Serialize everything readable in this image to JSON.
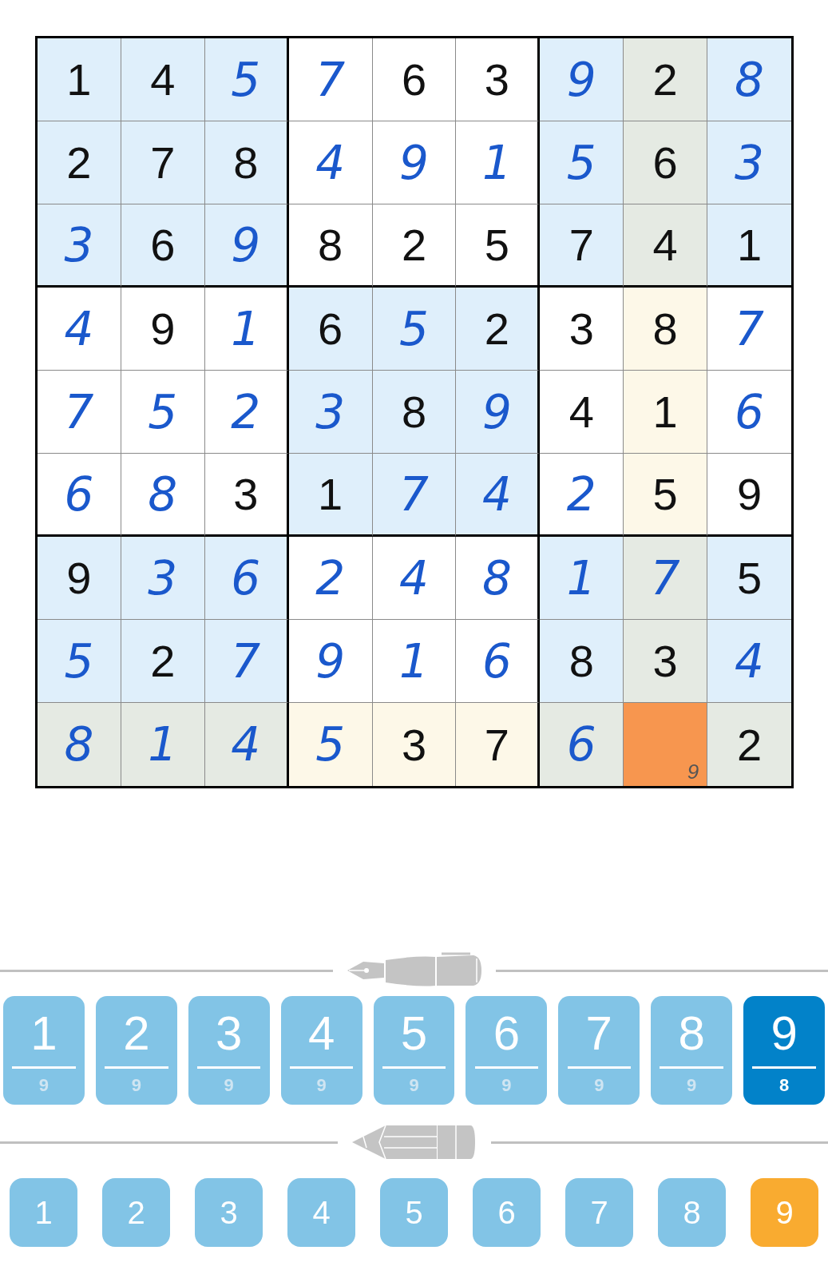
{
  "grid": {
    "rows": [
      {
        "cells": [
          {
            "value": "1",
            "kind": "given",
            "color": "#dfeffb"
          },
          {
            "value": "4",
            "kind": "given",
            "color": "#dfeffb"
          },
          {
            "value": "5",
            "kind": "entered",
            "color": "#dfeffb"
          },
          {
            "value": "7",
            "kind": "entered",
            "color": "#ffffff"
          },
          {
            "value": "6",
            "kind": "given",
            "color": "#ffffff"
          },
          {
            "value": "3",
            "kind": "given",
            "color": "#ffffff"
          },
          {
            "value": "9",
            "kind": "entered",
            "color": "#dfeffb"
          },
          {
            "value": "2",
            "kind": "given",
            "color": "#e5eae3"
          },
          {
            "value": "8",
            "kind": "entered",
            "color": "#dfeffb"
          }
        ]
      },
      {
        "cells": [
          {
            "value": "2",
            "kind": "given",
            "color": "#dfeffb"
          },
          {
            "value": "7",
            "kind": "given",
            "color": "#dfeffb"
          },
          {
            "value": "8",
            "kind": "given",
            "color": "#dfeffb"
          },
          {
            "value": "4",
            "kind": "entered",
            "color": "#ffffff"
          },
          {
            "value": "9",
            "kind": "entered",
            "color": "#ffffff"
          },
          {
            "value": "1",
            "kind": "entered",
            "color": "#ffffff"
          },
          {
            "value": "5",
            "kind": "entered",
            "color": "#dfeffb"
          },
          {
            "value": "6",
            "kind": "given",
            "color": "#e5eae3"
          },
          {
            "value": "3",
            "kind": "entered",
            "color": "#dfeffb"
          }
        ]
      },
      {
        "cells": [
          {
            "value": "3",
            "kind": "entered",
            "color": "#dfeffb"
          },
          {
            "value": "6",
            "kind": "given",
            "color": "#dfeffb"
          },
          {
            "value": "9",
            "kind": "entered",
            "color": "#dfeffb"
          },
          {
            "value": "8",
            "kind": "given",
            "color": "#ffffff"
          },
          {
            "value": "2",
            "kind": "given",
            "color": "#ffffff"
          },
          {
            "value": "5",
            "kind": "given",
            "color": "#ffffff"
          },
          {
            "value": "7",
            "kind": "given",
            "color": "#dfeffb"
          },
          {
            "value": "4",
            "kind": "given",
            "color": "#e5eae3"
          },
          {
            "value": "1",
            "kind": "given",
            "color": "#dfeffb"
          }
        ]
      },
      {
        "cells": [
          {
            "value": "4",
            "kind": "entered",
            "color": "#ffffff"
          },
          {
            "value": "9",
            "kind": "given",
            "color": "#ffffff"
          },
          {
            "value": "1",
            "kind": "entered",
            "color": "#ffffff"
          },
          {
            "value": "6",
            "kind": "given",
            "color": "#dfeffb"
          },
          {
            "value": "5",
            "kind": "entered",
            "color": "#dfeffb"
          },
          {
            "value": "2",
            "kind": "given",
            "color": "#dfeffb"
          },
          {
            "value": "3",
            "kind": "given",
            "color": "#ffffff"
          },
          {
            "value": "8",
            "kind": "given",
            "color": "#fdf8e8"
          },
          {
            "value": "7",
            "kind": "entered",
            "color": "#ffffff"
          }
        ]
      },
      {
        "cells": [
          {
            "value": "7",
            "kind": "entered",
            "color": "#ffffff"
          },
          {
            "value": "5",
            "kind": "entered",
            "color": "#ffffff"
          },
          {
            "value": "2",
            "kind": "entered",
            "color": "#ffffff"
          },
          {
            "value": "3",
            "kind": "entered",
            "color": "#dfeffb"
          },
          {
            "value": "8",
            "kind": "given",
            "color": "#dfeffb"
          },
          {
            "value": "9",
            "kind": "entered",
            "color": "#dfeffb"
          },
          {
            "value": "4",
            "kind": "given",
            "color": "#ffffff"
          },
          {
            "value": "1",
            "kind": "given",
            "color": "#fdf8e8"
          },
          {
            "value": "6",
            "kind": "entered",
            "color": "#ffffff"
          }
        ]
      },
      {
        "cells": [
          {
            "value": "6",
            "kind": "entered",
            "color": "#ffffff"
          },
          {
            "value": "8",
            "kind": "entered",
            "color": "#ffffff"
          },
          {
            "value": "3",
            "kind": "given",
            "color": "#ffffff"
          },
          {
            "value": "1",
            "kind": "given",
            "color": "#dfeffb"
          },
          {
            "value": "7",
            "kind": "entered",
            "color": "#dfeffb"
          },
          {
            "value": "4",
            "kind": "entered",
            "color": "#dfeffb"
          },
          {
            "value": "2",
            "kind": "entered",
            "color": "#ffffff"
          },
          {
            "value": "5",
            "kind": "given",
            "color": "#fdf8e8"
          },
          {
            "value": "9",
            "kind": "given",
            "color": "#ffffff"
          }
        ]
      },
      {
        "cells": [
          {
            "value": "9",
            "kind": "given",
            "color": "#dfeffb"
          },
          {
            "value": "3",
            "kind": "entered",
            "color": "#dfeffb"
          },
          {
            "value": "6",
            "kind": "entered",
            "color": "#dfeffb"
          },
          {
            "value": "2",
            "kind": "entered",
            "color": "#ffffff"
          },
          {
            "value": "4",
            "kind": "entered",
            "color": "#ffffff"
          },
          {
            "value": "8",
            "kind": "entered",
            "color": "#ffffff"
          },
          {
            "value": "1",
            "kind": "entered",
            "color": "#dfeffb"
          },
          {
            "value": "7",
            "kind": "entered",
            "color": "#e5eae3"
          },
          {
            "value": "5",
            "kind": "given",
            "color": "#dfeffb"
          }
        ]
      },
      {
        "cells": [
          {
            "value": "5",
            "kind": "entered",
            "color": "#dfeffb"
          },
          {
            "value": "2",
            "kind": "given",
            "color": "#dfeffb"
          },
          {
            "value": "7",
            "kind": "entered",
            "color": "#dfeffb"
          },
          {
            "value": "9",
            "kind": "entered",
            "color": "#ffffff"
          },
          {
            "value": "1",
            "kind": "entered",
            "color": "#ffffff"
          },
          {
            "value": "6",
            "kind": "entered",
            "color": "#ffffff"
          },
          {
            "value": "8",
            "kind": "given",
            "color": "#dfeffb"
          },
          {
            "value": "3",
            "kind": "given",
            "color": "#e5eae3"
          },
          {
            "value": "4",
            "kind": "entered",
            "color": "#dfeffb"
          }
        ]
      },
      {
        "cells": [
          {
            "value": "8",
            "kind": "entered",
            "color": "#e5eae3"
          },
          {
            "value": "1",
            "kind": "entered",
            "color": "#e5eae3"
          },
          {
            "value": "4",
            "kind": "entered",
            "color": "#e5eae3"
          },
          {
            "value": "5",
            "kind": "entered",
            "color": "#fdf8e8"
          },
          {
            "value": "3",
            "kind": "given",
            "color": "#fdf8e8"
          },
          {
            "value": "7",
            "kind": "given",
            "color": "#fdf8e8"
          },
          {
            "value": "6",
            "kind": "entered",
            "color": "#e5eae3"
          },
          {
            "kind": "empty",
            "color": "#f7964f",
            "notes": [
              "9"
            ]
          },
          {
            "value": "2",
            "kind": "given",
            "color": "#e5eae3"
          }
        ]
      }
    ]
  },
  "pen_pad": [
    {
      "label": "1",
      "count": "9",
      "selected": false
    },
    {
      "label": "2",
      "count": "9",
      "selected": false
    },
    {
      "label": "3",
      "count": "9",
      "selected": false
    },
    {
      "label": "4",
      "count": "9",
      "selected": false
    },
    {
      "label": "5",
      "count": "9",
      "selected": false
    },
    {
      "label": "6",
      "count": "9",
      "selected": false
    },
    {
      "label": "7",
      "count": "9",
      "selected": false
    },
    {
      "label": "8",
      "count": "9",
      "selected": false
    },
    {
      "label": "9",
      "count": "8",
      "selected": true
    }
  ],
  "pencil_pad": [
    {
      "label": "1",
      "selected": false
    },
    {
      "label": "2",
      "selected": false
    },
    {
      "label": "3",
      "selected": false
    },
    {
      "label": "4",
      "selected": false
    },
    {
      "label": "5",
      "selected": false
    },
    {
      "label": "6",
      "selected": false
    },
    {
      "label": "7",
      "selected": false
    },
    {
      "label": "8",
      "selected": false
    },
    {
      "label": "9",
      "selected": true
    }
  ]
}
